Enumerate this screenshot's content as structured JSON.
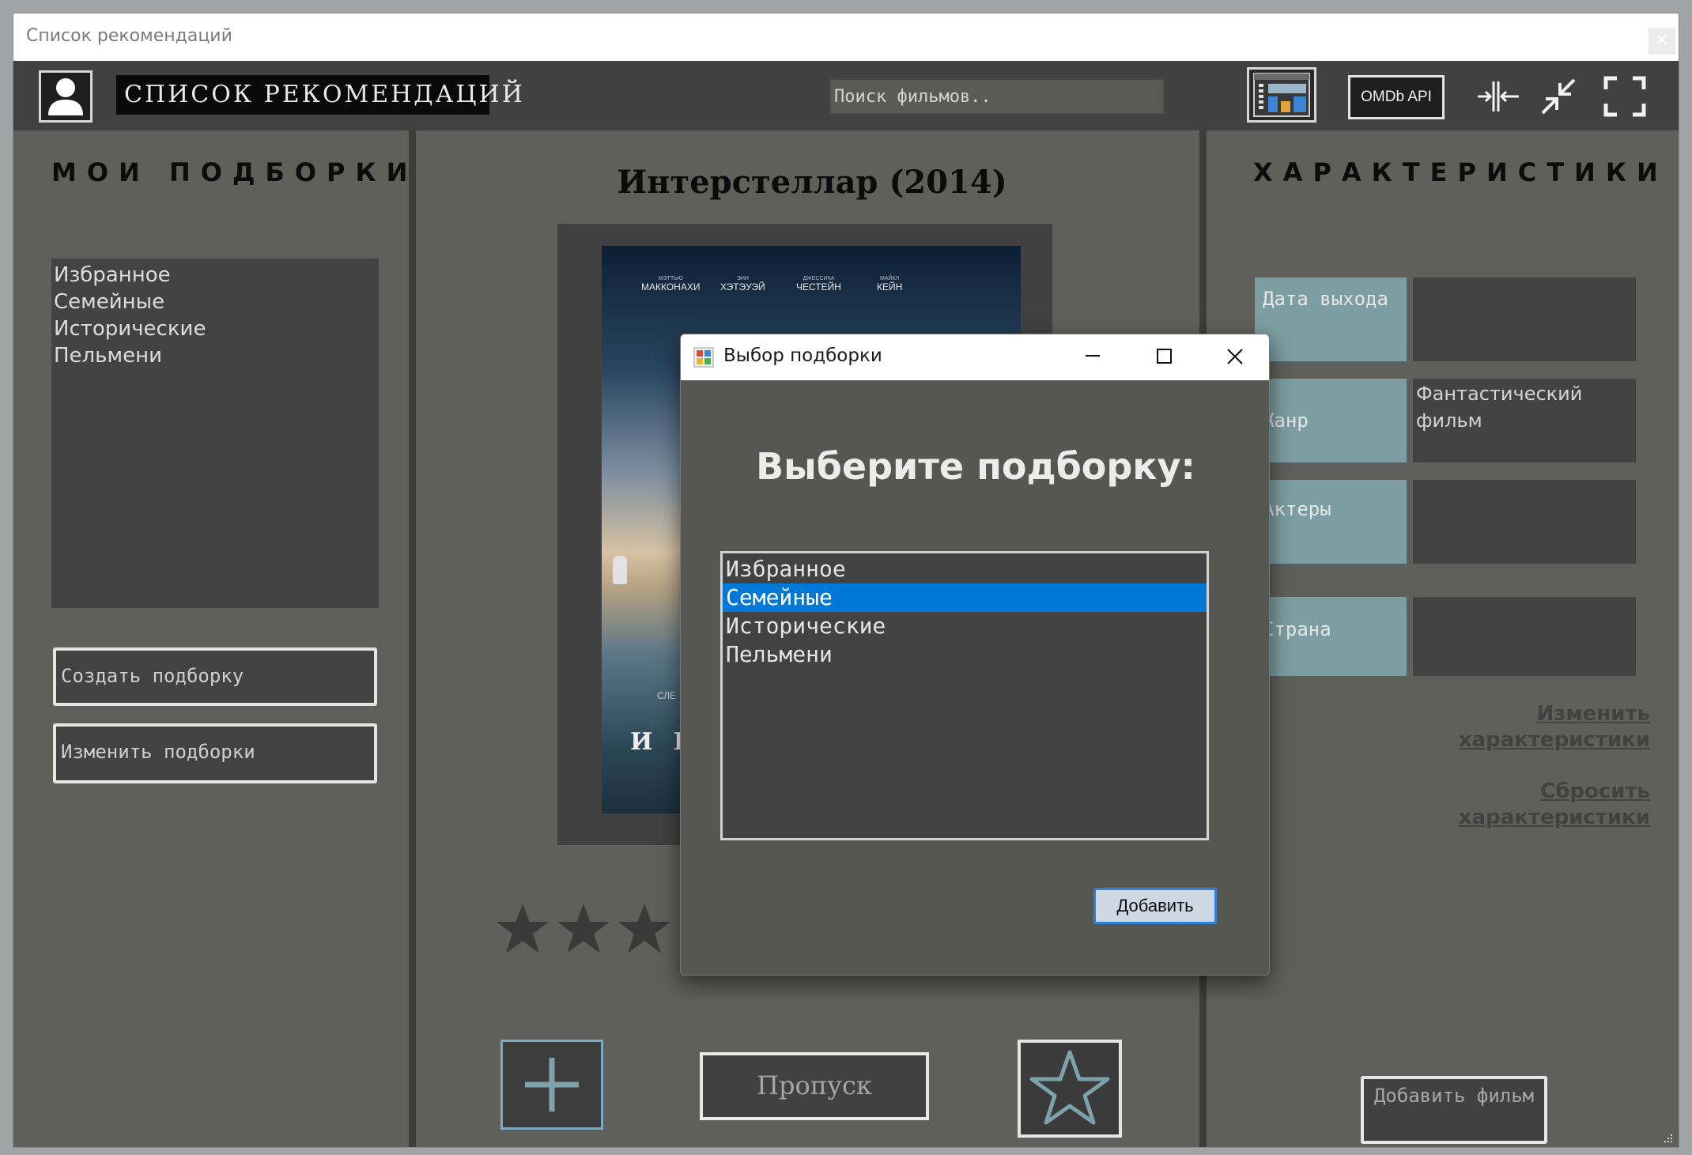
{
  "window": {
    "title": "Список рекомендаций",
    "close_glyph": "×"
  },
  "header": {
    "logo_text": "СПИСОК РЕКОМЕНДАЦИЙ",
    "search_placeholder": "Поиск фильмов..",
    "omdb_label": "OMDb API",
    "icons": [
      "user-icon",
      "dashboard-icon",
      "collapse-icon",
      "minimize-icon",
      "fullscreen-icon"
    ]
  },
  "left_panel": {
    "title": "МОИ ПОДБОРКИ",
    "collections": [
      "Избранное",
      "Семейные",
      "Исторические",
      "Пельмени"
    ],
    "create_label": "Создать подборку",
    "edit_label": "Изменить подборки"
  },
  "center": {
    "movie_title": "Интерстеллар (2014)",
    "poster": {
      "actors": [
        "МАККОНАХИ",
        "ХЭТЭУЭЙ",
        "ЧЕСТЕЙН",
        "КЕЙН"
      ],
      "actor_first": [
        "МЭТТЬЮ",
        "ЭНН",
        "ДЖЕССИКА",
        "МАЙКЛ"
      ],
      "letters": "И Н",
      "subtext": "СЛЕ"
    },
    "rating": {
      "value": 3,
      "max": 5
    },
    "skip_label": "Пропуск"
  },
  "right_panel": {
    "title": "ХАРАКТЕРИСТИКИ",
    "characteristics": [
      {
        "label": "Дата выхода",
        "value": ""
      },
      {
        "label": "Жанр",
        "value": "Фантастический фильм"
      },
      {
        "label": "Актеры",
        "value": ""
      },
      {
        "label": "Страна",
        "value": ""
      }
    ],
    "edit_link": "Изменить характеристики",
    "reset_link": "Сбросить характеристики",
    "add_film_label": "Добавить фильм"
  },
  "dialog": {
    "title": "Выбор подборки",
    "heading": "Выберите подборку:",
    "items": [
      "Избранное",
      "Семейные",
      "Исторические",
      "Пельмени"
    ],
    "selected_index": 1,
    "add_label": "Добавить"
  },
  "colors": {
    "app_bg": "#5f605b",
    "header_bg": "#414141",
    "accent_teal": "#7c9ea3",
    "selection_blue": "#0078d7",
    "dialog_bg": "#565752"
  }
}
